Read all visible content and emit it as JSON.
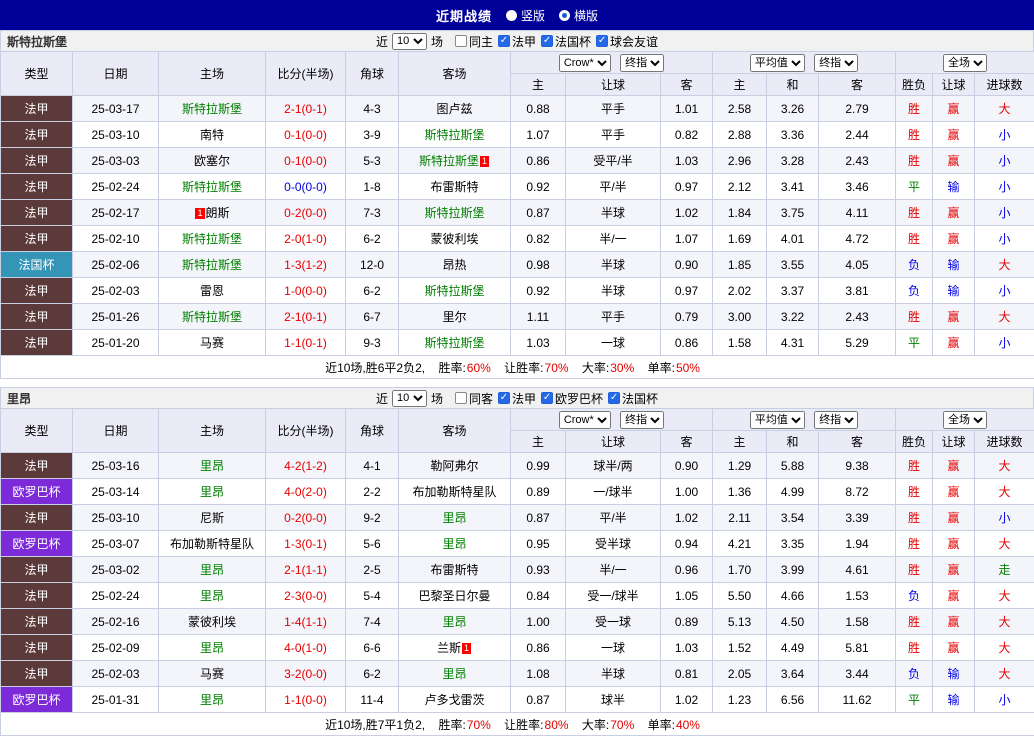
{
  "topbar": {
    "title": "近期战绩",
    "layout_options": [
      {
        "label": "竖版",
        "checked": false
      },
      {
        "label": "横版",
        "checked": true
      }
    ]
  },
  "table_headers": {
    "type": "类型",
    "date": "日期",
    "home": "主场",
    "score": "比分(半场)",
    "corner": "角球",
    "away": "客场",
    "select_company": "Crow*",
    "select_final_1": "终指",
    "select_average": "平均值",
    "select_final_2": "终指",
    "select_scope": "全场",
    "sub": [
      "主",
      "让球",
      "客",
      "主",
      "和",
      "客",
      "胜负",
      "让球",
      "进球数"
    ]
  },
  "filter_text": {
    "near": "近",
    "games": "场"
  },
  "colors": {
    "topbar_navy": "#000099",
    "ligue1_cell": "#5c3a3a",
    "coupe_de_france_cell": "#3595b6",
    "europa_league_cell": "#7d2bd9",
    "win_red": "#e60000",
    "lose_blue": "#0000e6",
    "draw_green": "#008000",
    "selected_team_green": "#008000"
  },
  "sections": [
    {
      "team": "斯特拉斯堡",
      "near_count": "10",
      "filters": [
        {
          "label": "同主",
          "checked": false
        },
        {
          "label": "法甲",
          "checked": true
        },
        {
          "label": "法国杯",
          "checked": true
        },
        {
          "label": "球会友谊",
          "checked": true
        }
      ],
      "rows": [
        {
          "league": "法甲",
          "league_c": "fa",
          "date": "25-03-17",
          "home": "斯特拉斯堡",
          "home_c": "g",
          "home_b1": "",
          "home_b2": "",
          "score": "2-1(0-1)",
          "score_c": "r",
          "corner": "4-3",
          "away": "图卢兹",
          "away_c": "k",
          "away_b1": "",
          "away_b2": "",
          "odds_home": "0.88",
          "handicap": "平手",
          "odds_away": "1.01",
          "avg_home": "2.58",
          "avg_draw": "3.26",
          "avg_away": "2.79",
          "wdl": "胜",
          "wdl_c": "r",
          "let": "赢",
          "let_c": "r",
          "goal": "大",
          "goal_c": "r"
        },
        {
          "league": "法甲",
          "league_c": "fa",
          "date": "25-03-10",
          "home": "南特",
          "home_c": "k",
          "home_b1": "",
          "home_b2": "",
          "score": "0-1(0-0)",
          "score_c": "r",
          "corner": "3-9",
          "away": "斯特拉斯堡",
          "away_c": "g",
          "away_b1": "",
          "away_b2": "",
          "odds_home": "1.07",
          "handicap": "平手",
          "odds_away": "0.82",
          "avg_home": "2.88",
          "avg_draw": "3.36",
          "avg_away": "2.44",
          "wdl": "胜",
          "wdl_c": "r",
          "let": "赢",
          "let_c": "r",
          "goal": "小",
          "goal_c": "b"
        },
        {
          "league": "法甲",
          "league_c": "fa",
          "date": "25-03-03",
          "home": "欧塞尔",
          "home_c": "k",
          "home_b1": "",
          "home_b2": "",
          "score": "0-1(0-0)",
          "score_c": "r",
          "corner": "5-3",
          "away": "斯特拉斯堡",
          "away_c": "g",
          "away_b1": "",
          "away_b2": "1",
          "odds_home": "0.86",
          "handicap": "受平/半",
          "odds_away": "1.03",
          "avg_home": "2.96",
          "avg_draw": "3.28",
          "avg_away": "2.43",
          "wdl": "胜",
          "wdl_c": "r",
          "let": "赢",
          "let_c": "r",
          "goal": "小",
          "goal_c": "b"
        },
        {
          "league": "法甲",
          "league_c": "fa",
          "date": "25-02-24",
          "home": "斯特拉斯堡",
          "home_c": "g",
          "home_b1": "",
          "home_b2": "",
          "score": "0-0(0-0)",
          "score_c": "b",
          "corner": "1-8",
          "away": "布雷斯特",
          "away_c": "k",
          "away_b1": "",
          "away_b2": "",
          "odds_home": "0.92",
          "handicap": "平/半",
          "odds_away": "0.97",
          "avg_home": "2.12",
          "avg_draw": "3.41",
          "avg_away": "3.46",
          "wdl": "平",
          "wdl_c": "g",
          "let": "输",
          "let_c": "b",
          "goal": "小",
          "goal_c": "b"
        },
        {
          "league": "法甲",
          "league_c": "fa",
          "date": "25-02-17",
          "home": "朗斯",
          "home_c": "k",
          "home_b1": "1",
          "home_b2": "",
          "score": "0-2(0-0)",
          "score_c": "r",
          "corner": "7-3",
          "away": "斯特拉斯堡",
          "away_c": "g",
          "away_b1": "",
          "away_b2": "",
          "odds_home": "0.87",
          "handicap": "半球",
          "odds_away": "1.02",
          "avg_home": "1.84",
          "avg_draw": "3.75",
          "avg_away": "4.11",
          "wdl": "胜",
          "wdl_c": "r",
          "let": "赢",
          "let_c": "r",
          "goal": "小",
          "goal_c": "b"
        },
        {
          "league": "法甲",
          "league_c": "fa",
          "date": "25-02-10",
          "home": "斯特拉斯堡",
          "home_c": "g",
          "home_b1": "",
          "home_b2": "",
          "score": "2-0(1-0)",
          "score_c": "r",
          "corner": "6-2",
          "away": "蒙彼利埃",
          "away_c": "k",
          "away_b1": "",
          "away_b2": "",
          "odds_home": "0.82",
          "handicap": "半/一",
          "odds_away": "1.07",
          "avg_home": "1.69",
          "avg_draw": "4.01",
          "avg_away": "4.72",
          "wdl": "胜",
          "wdl_c": "r",
          "let": "赢",
          "let_c": "r",
          "goal": "小",
          "goal_c": "b"
        },
        {
          "league": "法国杯",
          "league_c": "fgb",
          "date": "25-02-06",
          "home": "斯特拉斯堡",
          "home_c": "g",
          "home_b1": "",
          "home_b2": "",
          "score": "1-3(1-2)",
          "score_c": "r",
          "corner": "12-0",
          "away": "昂热",
          "away_c": "k",
          "away_b1": "",
          "away_b2": "",
          "odds_home": "0.98",
          "handicap": "半球",
          "odds_away": "0.90",
          "avg_home": "1.85",
          "avg_draw": "3.55",
          "avg_away": "4.05",
          "wdl": "负",
          "wdl_c": "b",
          "let": "输",
          "let_c": "b",
          "goal": "大",
          "goal_c": "r"
        },
        {
          "league": "法甲",
          "league_c": "fa",
          "date": "25-02-03",
          "home": "雷恩",
          "home_c": "k",
          "home_b1": "",
          "home_b2": "",
          "score": "1-0(0-0)",
          "score_c": "r",
          "corner": "6-2",
          "away": "斯特拉斯堡",
          "away_c": "g",
          "away_b1": "",
          "away_b2": "",
          "odds_home": "0.92",
          "handicap": "半球",
          "odds_away": "0.97",
          "avg_home": "2.02",
          "avg_draw": "3.37",
          "avg_away": "3.81",
          "wdl": "负",
          "wdl_c": "b",
          "let": "输",
          "let_c": "b",
          "goal": "小",
          "goal_c": "b"
        },
        {
          "league": "法甲",
          "league_c": "fa",
          "date": "25-01-26",
          "home": "斯特拉斯堡",
          "home_c": "g",
          "home_b1": "",
          "home_b2": "",
          "score": "2-1(0-1)",
          "score_c": "r",
          "corner": "6-7",
          "away": "里尔",
          "away_c": "k",
          "away_b1": "",
          "away_b2": "",
          "odds_home": "1.11",
          "handicap": "平手",
          "odds_away": "0.79",
          "avg_home": "3.00",
          "avg_draw": "3.22",
          "avg_away": "2.43",
          "wdl": "胜",
          "wdl_c": "r",
          "let": "赢",
          "let_c": "r",
          "goal": "大",
          "goal_c": "r"
        },
        {
          "league": "法甲",
          "league_c": "fa",
          "date": "25-01-20",
          "home": "马赛",
          "home_c": "k",
          "home_b1": "",
          "home_b2": "",
          "score": "1-1(0-1)",
          "score_c": "r",
          "corner": "9-3",
          "away": "斯特拉斯堡",
          "away_c": "g",
          "away_b1": "",
          "away_b2": "",
          "odds_home": "1.03",
          "handicap": "一球",
          "odds_away": "0.86",
          "avg_home": "1.58",
          "avg_draw": "4.31",
          "avg_away": "5.29",
          "wdl": "平",
          "wdl_c": "g",
          "let": "赢",
          "let_c": "r",
          "goal": "小",
          "goal_c": "b"
        }
      ],
      "summary": {
        "prefix": "近10场,胜6平2负2,",
        "stats": [
          {
            "label": "胜率:",
            "value": "60%"
          },
          {
            "label": "让胜率:",
            "value": "70%"
          },
          {
            "label": "大率:",
            "value": "30%"
          },
          {
            "label": "单率:",
            "value": "50%"
          }
        ]
      }
    },
    {
      "team": "里昂",
      "near_count": "10",
      "filters": [
        {
          "label": "同客",
          "checked": false
        },
        {
          "label": "法甲",
          "checked": true
        },
        {
          "label": "欧罗巴杯",
          "checked": true
        },
        {
          "label": "法国杯",
          "checked": true
        }
      ],
      "rows": [
        {
          "league": "法甲",
          "league_c": "fa",
          "date": "25-03-16",
          "home": "里昂",
          "home_c": "g",
          "home_b1": "",
          "home_b2": "",
          "score": "4-2(1-2)",
          "score_c": "r",
          "corner": "4-1",
          "away": "勒阿弗尔",
          "away_c": "k",
          "away_b1": "",
          "away_b2": "",
          "odds_home": "0.99",
          "handicap": "球半/两",
          "odds_away": "0.90",
          "avg_home": "1.29",
          "avg_draw": "5.88",
          "avg_away": "9.38",
          "wdl": "胜",
          "wdl_c": "r",
          "let": "赢",
          "let_c": "r",
          "goal": "大",
          "goal_c": "r"
        },
        {
          "league": "欧罗巴杯",
          "league_c": "olb",
          "date": "25-03-14",
          "home": "里昂",
          "home_c": "g",
          "home_b1": "",
          "home_b2": "",
          "score": "4-0(2-0)",
          "score_c": "r",
          "corner": "2-2",
          "away": "布加勒斯特星队",
          "away_c": "k",
          "away_b1": "",
          "away_b2": "",
          "odds_home": "0.89",
          "handicap": "一/球半",
          "odds_away": "1.00",
          "avg_home": "1.36",
          "avg_draw": "4.99",
          "avg_away": "8.72",
          "wdl": "胜",
          "wdl_c": "r",
          "let": "赢",
          "let_c": "r",
          "goal": "大",
          "goal_c": "r"
        },
        {
          "league": "法甲",
          "league_c": "fa",
          "date": "25-03-10",
          "home": "尼斯",
          "home_c": "k",
          "home_b1": "",
          "home_b2": "",
          "score": "0-2(0-0)",
          "score_c": "r",
          "corner": "9-2",
          "away": "里昂",
          "away_c": "g",
          "away_b1": "",
          "away_b2": "",
          "odds_home": "0.87",
          "handicap": "平/半",
          "odds_away": "1.02",
          "avg_home": "2.11",
          "avg_draw": "3.54",
          "avg_away": "3.39",
          "wdl": "胜",
          "wdl_c": "r",
          "let": "赢",
          "let_c": "r",
          "goal": "小",
          "goal_c": "b"
        },
        {
          "league": "欧罗巴杯",
          "league_c": "olb",
          "date": "25-03-07",
          "home": "布加勒斯特星队",
          "home_c": "k",
          "home_b1": "",
          "home_b2": "",
          "score": "1-3(0-1)",
          "score_c": "r",
          "corner": "5-6",
          "away": "里昂",
          "away_c": "g",
          "away_b1": "",
          "away_b2": "",
          "odds_home": "0.95",
          "handicap": "受半球",
          "odds_away": "0.94",
          "avg_home": "4.21",
          "avg_draw": "3.35",
          "avg_away": "1.94",
          "wdl": "胜",
          "wdl_c": "r",
          "let": "赢",
          "let_c": "r",
          "goal": "大",
          "goal_c": "r"
        },
        {
          "league": "法甲",
          "league_c": "fa",
          "date": "25-03-02",
          "home": "里昂",
          "home_c": "g",
          "home_b1": "",
          "home_b2": "",
          "score": "2-1(1-1)",
          "score_c": "r",
          "corner": "2-5",
          "away": "布雷斯特",
          "away_c": "k",
          "away_b1": "",
          "away_b2": "",
          "odds_home": "0.93",
          "handicap": "半/一",
          "odds_away": "0.96",
          "avg_home": "1.70",
          "avg_draw": "3.99",
          "avg_away": "4.61",
          "wdl": "胜",
          "wdl_c": "r",
          "let": "赢",
          "let_c": "r",
          "goal": "走",
          "goal_c": "g"
        },
        {
          "league": "法甲",
          "league_c": "fa",
          "date": "25-02-24",
          "home": "里昂",
          "home_c": "g",
          "home_b1": "",
          "home_b2": "",
          "score": "2-3(0-0)",
          "score_c": "r",
          "corner": "5-4",
          "away": "巴黎圣日尔曼",
          "away_c": "k",
          "away_b1": "",
          "away_b2": "",
          "odds_home": "0.84",
          "handicap": "受一/球半",
          "odds_away": "1.05",
          "avg_home": "5.50",
          "avg_draw": "4.66",
          "avg_away": "1.53",
          "wdl": "负",
          "wdl_c": "b",
          "let": "赢",
          "let_c": "r",
          "goal": "大",
          "goal_c": "r"
        },
        {
          "league": "法甲",
          "league_c": "fa",
          "date": "25-02-16",
          "home": "蒙彼利埃",
          "home_c": "k",
          "home_b1": "",
          "home_b2": "",
          "score": "1-4(1-1)",
          "score_c": "r",
          "corner": "7-4",
          "away": "里昂",
          "away_c": "g",
          "away_b1": "",
          "away_b2": "",
          "odds_home": "1.00",
          "handicap": "受一球",
          "odds_away": "0.89",
          "avg_home": "5.13",
          "avg_draw": "4.50",
          "avg_away": "1.58",
          "wdl": "胜",
          "wdl_c": "r",
          "let": "赢",
          "let_c": "r",
          "goal": "大",
          "goal_c": "r"
        },
        {
          "league": "法甲",
          "league_c": "fa",
          "date": "25-02-09",
          "home": "里昂",
          "home_c": "g",
          "home_b1": "",
          "home_b2": "",
          "score": "4-0(1-0)",
          "score_c": "r",
          "corner": "6-6",
          "away": "兰斯",
          "away_c": "k",
          "away_b1": "",
          "away_b2": "1",
          "odds_home": "0.86",
          "handicap": "一球",
          "odds_away": "1.03",
          "avg_home": "1.52",
          "avg_draw": "4.49",
          "avg_away": "5.81",
          "wdl": "胜",
          "wdl_c": "r",
          "let": "赢",
          "let_c": "r",
          "goal": "大",
          "goal_c": "r"
        },
        {
          "league": "法甲",
          "league_c": "fa",
          "date": "25-02-03",
          "home": "马赛",
          "home_c": "k",
          "home_b1": "",
          "home_b2": "",
          "score": "3-2(0-0)",
          "score_c": "r",
          "corner": "6-2",
          "away": "里昂",
          "away_c": "g",
          "away_b1": "",
          "away_b2": "",
          "odds_home": "1.08",
          "handicap": "半球",
          "odds_away": "0.81",
          "avg_home": "2.05",
          "avg_draw": "3.64",
          "avg_away": "3.44",
          "wdl": "负",
          "wdl_c": "b",
          "let": "输",
          "let_c": "b",
          "goal": "大",
          "goal_c": "r"
        },
        {
          "league": "欧罗巴杯",
          "league_c": "olb",
          "date": "25-01-31",
          "home": "里昂",
          "home_c": "g",
          "home_b1": "",
          "home_b2": "",
          "score": "1-1(0-0)",
          "score_c": "r",
          "corner": "11-4",
          "away": "卢多戈雷茨",
          "away_c": "k",
          "away_b1": "",
          "away_b2": "",
          "odds_home": "0.87",
          "handicap": "球半",
          "odds_away": "1.02",
          "avg_home": "1.23",
          "avg_draw": "6.56",
          "avg_away": "11.62",
          "wdl": "平",
          "wdl_c": "g",
          "let": "输",
          "let_c": "b",
          "goal": "小",
          "goal_c": "b"
        }
      ],
      "summary": {
        "prefix": "近10场,胜7平1负2,",
        "stats": [
          {
            "label": "胜率:",
            "value": "70%"
          },
          {
            "label": "让胜率:",
            "value": "80%"
          },
          {
            "label": "大率:",
            "value": "70%"
          },
          {
            "label": "单率:",
            "value": "40%"
          }
        ]
      }
    }
  ]
}
